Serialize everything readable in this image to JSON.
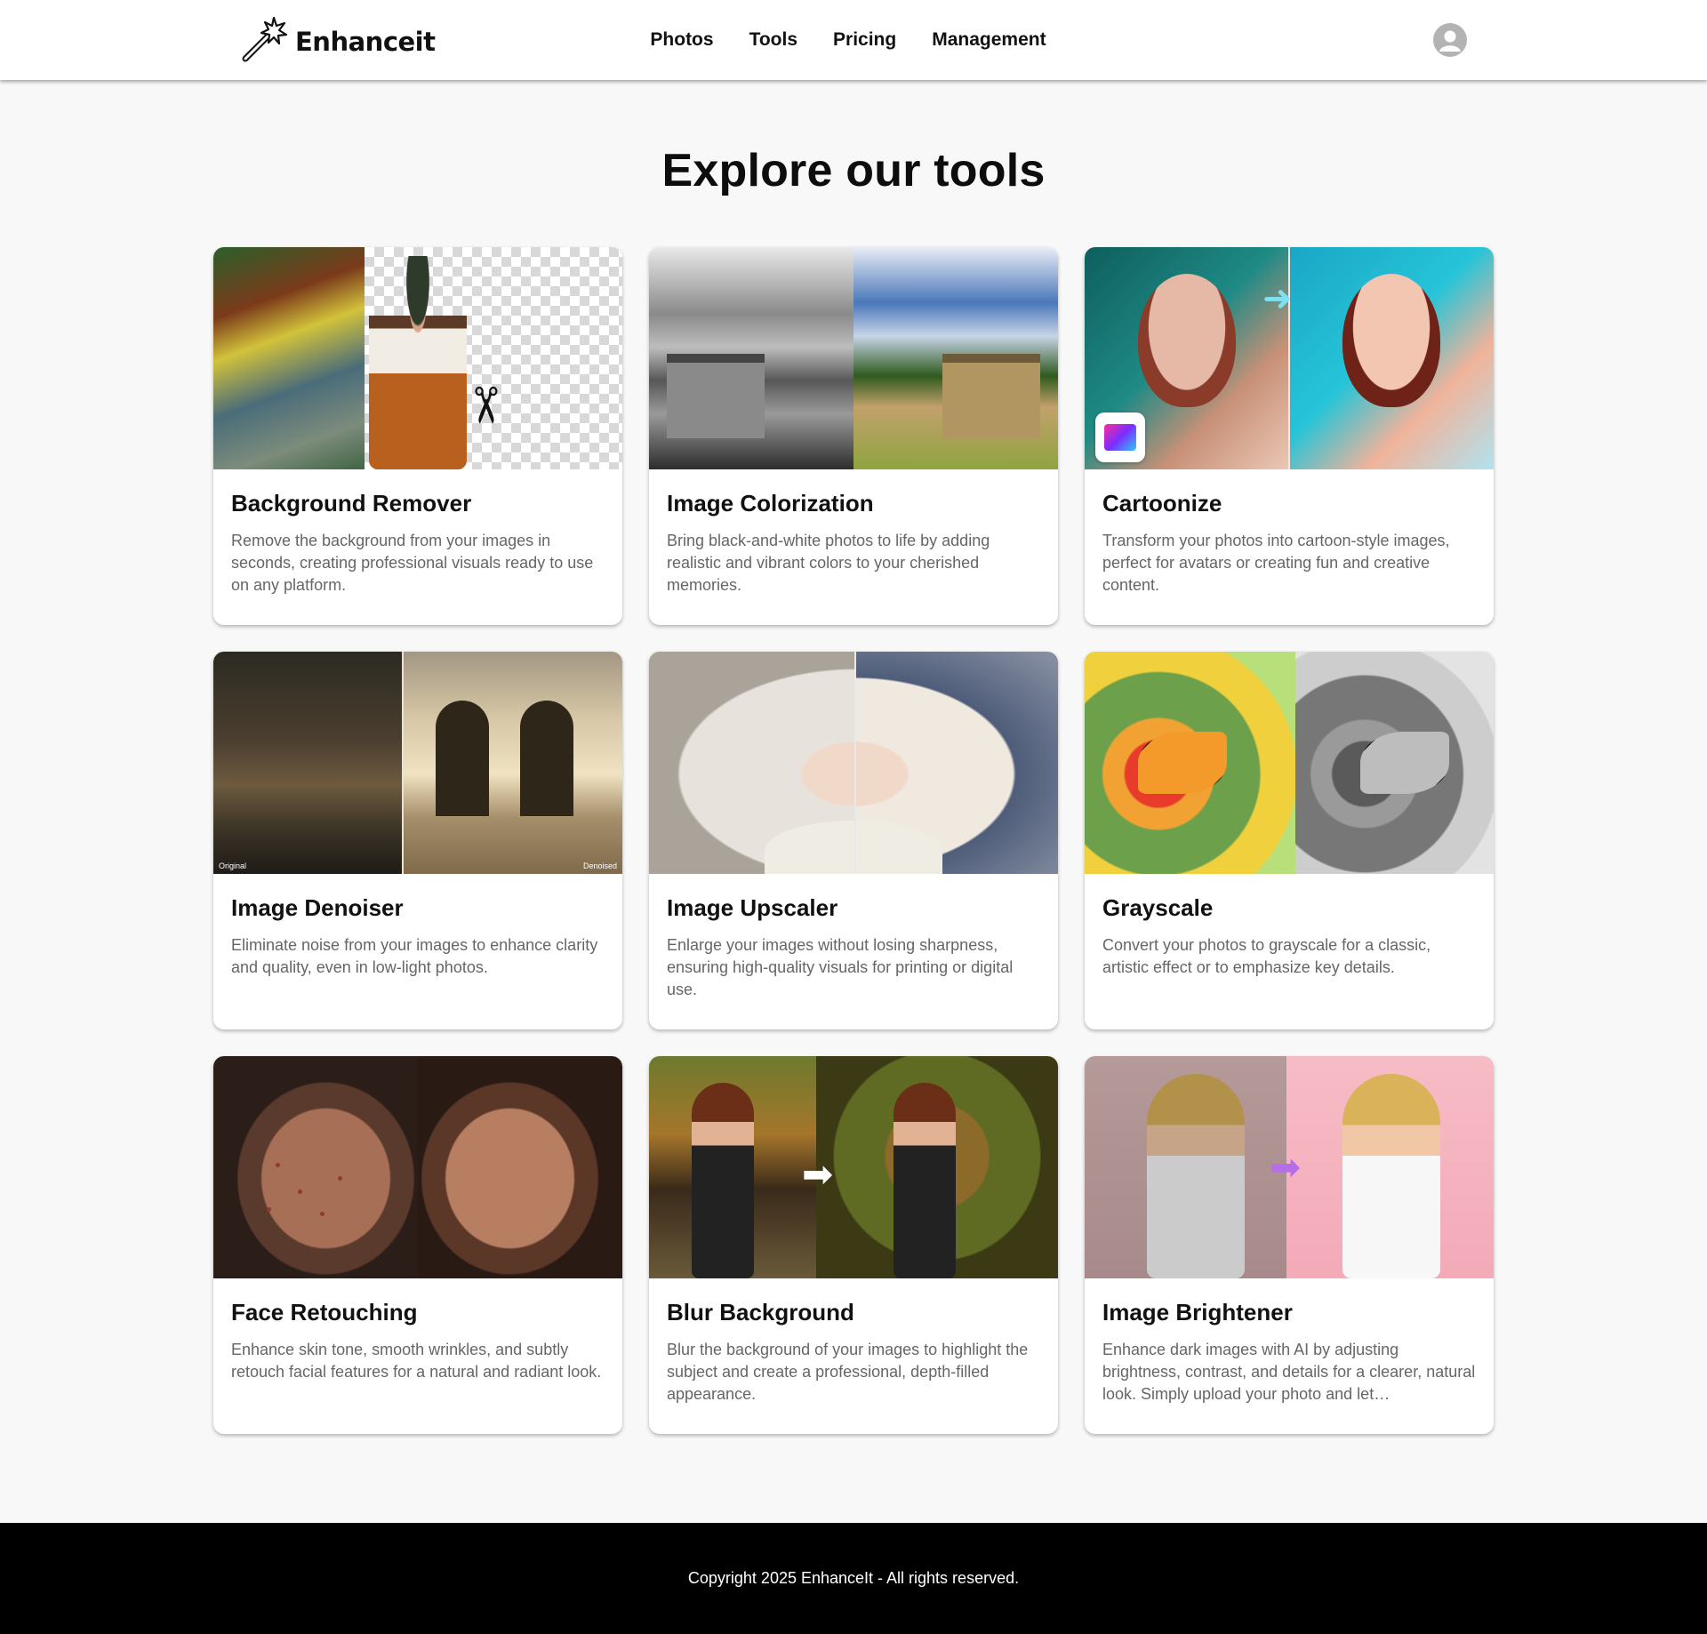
{
  "header": {
    "brand": "Enhanceit",
    "logo_icon": "magic-wand-icon",
    "nav": [
      "Photos",
      "Tools",
      "Pricing",
      "Management"
    ],
    "avatar_icon": "user-avatar-icon"
  },
  "main": {
    "title": "Explore our tools",
    "tools": [
      {
        "title": "Background Remover",
        "description": "Remove the background from your images in seconds, creating professional visuals ready to use on any platform."
      },
      {
        "title": "Image Colorization",
        "description": "Bring black-and-white photos to life by adding realistic and vibrant colors to your cherished memories."
      },
      {
        "title": "Cartoonize",
        "description": "Transform your photos into cartoon-style images, perfect for avatars or creating fun and creative content."
      },
      {
        "title": "Image Denoiser",
        "description": "Eliminate noise from your images to enhance clarity and quality, even in low-light photos.",
        "thumb_labels": [
          "Original",
          "Denoised"
        ]
      },
      {
        "title": "Image Upscaler",
        "description": "Enlarge your images without losing sharpness, ensuring high-quality visuals for printing or digital use."
      },
      {
        "title": "Grayscale",
        "description": "Convert your photos to grayscale for a classic, artistic effect or to emphasize key details."
      },
      {
        "title": "Face Retouching",
        "description": "Enhance skin tone, smooth wrinkles, and subtly retouch facial features for a natural and radiant look."
      },
      {
        "title": "Blur Background",
        "description": "Blur the background of your images to highlight the subject and create a professional, depth-filled appearance."
      },
      {
        "title": "Image Brightener",
        "description": "Enhance dark images with AI by adjusting brightness, contrast, and details for a clearer, natural look. Simply upload your photo and let…"
      }
    ]
  },
  "footer": {
    "copyright": "Copyright 2025 EnhanceIt - All rights reserved."
  },
  "colors": {
    "header_bg": "#ffffff",
    "page_bg": "#f8f8f8",
    "footer_bg": "#000000",
    "description_text": "#666666"
  }
}
